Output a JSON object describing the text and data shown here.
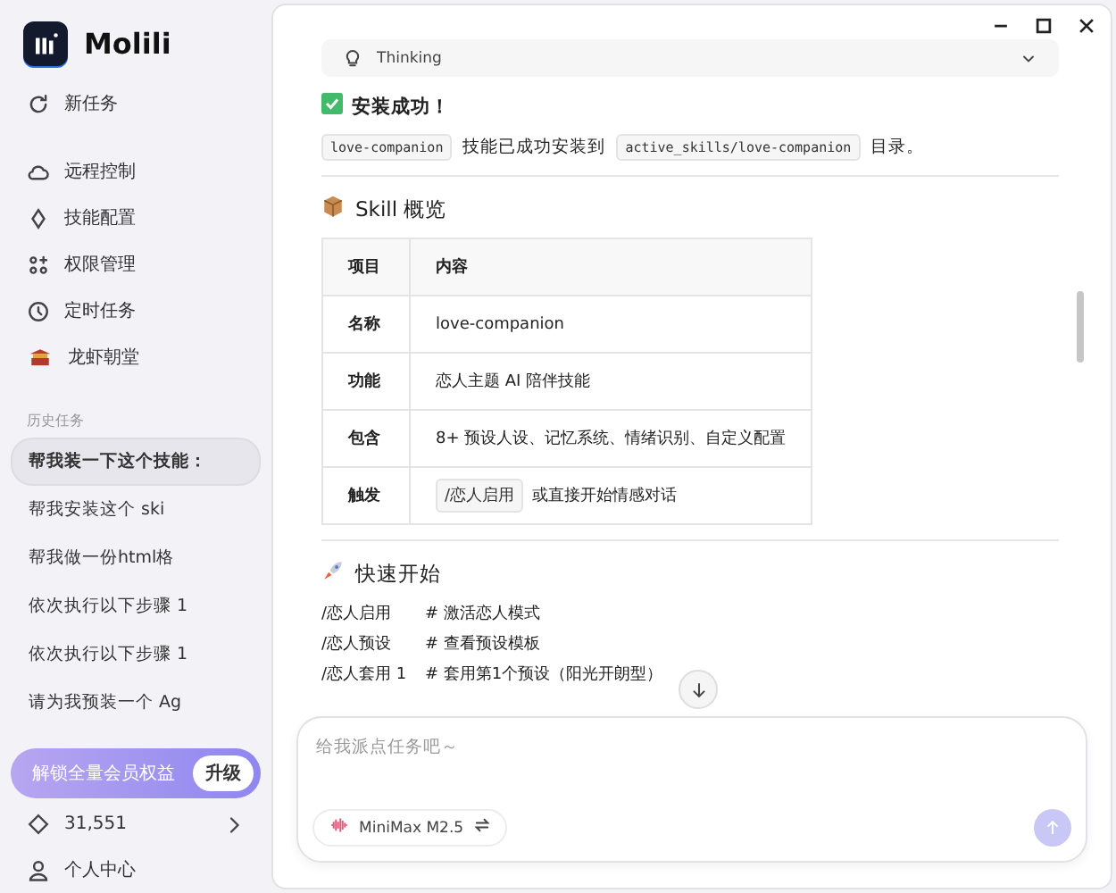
{
  "app": {
    "name": "Molili"
  },
  "sidebar": {
    "new_task": "新任务",
    "nav": [
      {
        "label": "远程控制"
      },
      {
        "label": "技能配置"
      },
      {
        "label": "权限管理"
      },
      {
        "label": "定时任务"
      },
      {
        "label": "龙虾朝堂"
      }
    ],
    "history_title": "历史任务",
    "history": [
      {
        "label": "帮我装一下这个技能：",
        "selected": true
      },
      {
        "label": "帮我安装这个 ski",
        "selected": false
      },
      {
        "label": "帮我做一份html格",
        "selected": false
      },
      {
        "label": "依次执行以下步骤 1",
        "selected": false
      },
      {
        "label": "依次执行以下步骤 1",
        "selected": false
      },
      {
        "label": "请为我预装一个 Ag",
        "selected": false
      }
    ],
    "promo": {
      "text": "解锁全量会员权益",
      "button": "升级"
    },
    "points": "31,551",
    "profile": "个人中心"
  },
  "chat": {
    "thinking": "Thinking",
    "success": "安装成功！",
    "install_line": [
      {
        "kind": "code",
        "text": "love-companion"
      },
      {
        "kind": "text",
        "text": "技能已成功安装到"
      },
      {
        "kind": "code",
        "text": "active_skills/love-companion"
      },
      {
        "kind": "text",
        "text": "目录。"
      }
    ],
    "overview_heading": "Skill 概览",
    "table": {
      "columns": [
        "项目",
        "内容"
      ],
      "rows": [
        {
          "key": "名称",
          "value": [
            {
              "kind": "text",
              "text": "love-companion"
            }
          ]
        },
        {
          "key": "功能",
          "value": [
            {
              "kind": "text",
              "text": "恋人主题 AI 陪伴技能"
            }
          ]
        },
        {
          "key": "包含",
          "value": [
            {
              "kind": "text",
              "text": "8+ 预设人设、记忆系统、情绪识别、自定义配置"
            }
          ]
        },
        {
          "key": "触发",
          "value": [
            {
              "kind": "code",
              "text": "/恋人启用"
            },
            {
              "kind": "text",
              "text": "或直接开始情感对话"
            }
          ]
        }
      ]
    },
    "quick_heading": "快速开始",
    "commands": [
      {
        "command": "/恋人启用",
        "comment": "# 激活恋人模式"
      },
      {
        "command": "/恋人预设",
        "comment": "# 查看预设模板"
      },
      {
        "command": "/恋人套用 1",
        "comment": "# 套用第1个预设（阳光开朗型）"
      }
    ]
  },
  "composer": {
    "placeholder": "给我派点任务吧～",
    "model": "MiniMax M2.5"
  }
}
